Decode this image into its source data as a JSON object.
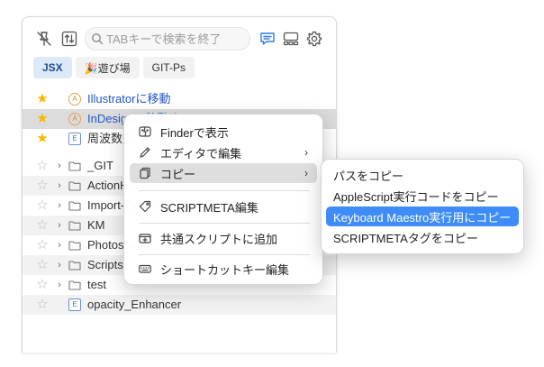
{
  "search": {
    "placeholder": "TABキーで検索を終了"
  },
  "toolbar": {
    "icons": [
      "pin-off-icon",
      "sort-icon",
      "search-icon",
      "comment-icon",
      "layout-icon",
      "gear-icon"
    ]
  },
  "tabs": [
    {
      "label": "JSX",
      "active": true
    },
    {
      "label": "🎉遊び場",
      "active": false
    },
    {
      "label": "GIT-Ps",
      "active": false
    }
  ],
  "list": [
    {
      "label": "Illustratorに移動",
      "starred": true,
      "icon": "circle-a"
    },
    {
      "label": "InDesignに移動する",
      "starred": true,
      "icon": "circle-a"
    },
    {
      "label": "周波数分割",
      "starred": true,
      "icon": "file-e"
    },
    {
      "label": "_GIT",
      "starred": false,
      "icon": "folder"
    },
    {
      "label": "ActionHub",
      "starred": false,
      "icon": "folder"
    },
    {
      "label": "Import-Export",
      "starred": false,
      "icon": "folder"
    },
    {
      "label": "KM",
      "starred": false,
      "icon": "folder"
    },
    {
      "label": "Photoshop",
      "starred": false,
      "icon": "folder"
    },
    {
      "label": "Scripts",
      "starred": false,
      "icon": "folder"
    },
    {
      "label": "test",
      "starred": false,
      "icon": "folder"
    },
    {
      "label": "opacity_Enhancer",
      "starred": false,
      "icon": "file-e"
    }
  ],
  "context_menu": {
    "items": [
      {
        "label": "Finderで表示",
        "icon": "finder-icon",
        "submenu": false
      },
      {
        "label": "エディタで編集",
        "icon": "edit-icon",
        "submenu": true
      },
      {
        "label": "コピー",
        "icon": "copy-icon",
        "submenu": true
      },
      {
        "label": "SCRIPTMETA編集",
        "icon": "tag-icon",
        "submenu": false
      },
      {
        "label": "共通スクリプトに追加",
        "icon": "add-shared-icon",
        "submenu": false
      },
      {
        "label": "ショートカットキー編集",
        "icon": "keyboard-icon",
        "submenu": false
      }
    ]
  },
  "copy_submenu": {
    "items": [
      {
        "label": "パスをコピー"
      },
      {
        "label": "AppleScript実行コードをコピー"
      },
      {
        "label": "Keyboard Maestro実行用にコピー"
      },
      {
        "label": "SCRIPTMETAタグをコピー"
      }
    ]
  },
  "colors": {
    "accent": "#3d8cf7",
    "star": "#f5b800",
    "link": "#2356c7"
  }
}
